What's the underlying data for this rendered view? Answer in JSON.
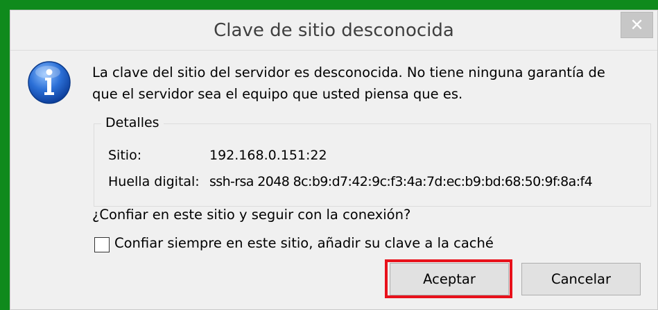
{
  "dialog": {
    "title": "Clave de sitio desconocida",
    "close_glyph": "✕",
    "icon": "info-icon",
    "message": "La clave del sitio del servidor es desconocida. No tiene ninguna garantía de\nque el servidor sea el equipo que usted piensa que es.",
    "details": {
      "legend": "Detalles",
      "site_label": "Sitio:",
      "site_value": "192.168.0.151:22",
      "fingerprint_label": "Huella digital:",
      "fingerprint_value": "ssh-rsa 2048 8c:b9:d7:42:9c:f3:4a:7d:ec:b9:bd:68:50:9f:8a:f4"
    },
    "question": "¿Confiar en este sitio y seguir con la conexión?",
    "checkbox_label": "Confiar siempre en este sitio, añadir su clave a la caché",
    "checkbox_checked": false,
    "ok_label": "Aceptar",
    "cancel_label": "Cancelar"
  },
  "colors": {
    "background_green": "#0f8a1c",
    "dialog_bg": "#f0f0f0",
    "highlight_red": "#e8111b",
    "info_blue": "#1e64c8"
  }
}
